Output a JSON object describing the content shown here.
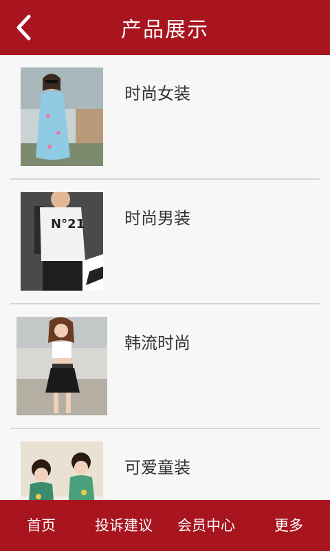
{
  "header": {
    "title": "产品展示",
    "back_icon": "chevron-left-icon"
  },
  "products": [
    {
      "label": "时尚女装",
      "image": "woman-in-blue-floral-dress-photo"
    },
    {
      "label": "时尚男装",
      "image": "man-in-white-n21-tshirt-photo"
    },
    {
      "label": "韩流时尚",
      "image": "woman-in-white-top-black-skirt-photo"
    },
    {
      "label": "可爱童装",
      "image": "children-in-floral-outfits-photo"
    }
  ],
  "tabbar": {
    "items": [
      {
        "label": "首页"
      },
      {
        "label": "投诉建议"
      },
      {
        "label": "会员中心"
      },
      {
        "label": "更多"
      }
    ]
  },
  "colors": {
    "brand": "#a8151f",
    "background": "#f7f7f7",
    "divider": "#d5d5d5",
    "text": "#333333"
  }
}
